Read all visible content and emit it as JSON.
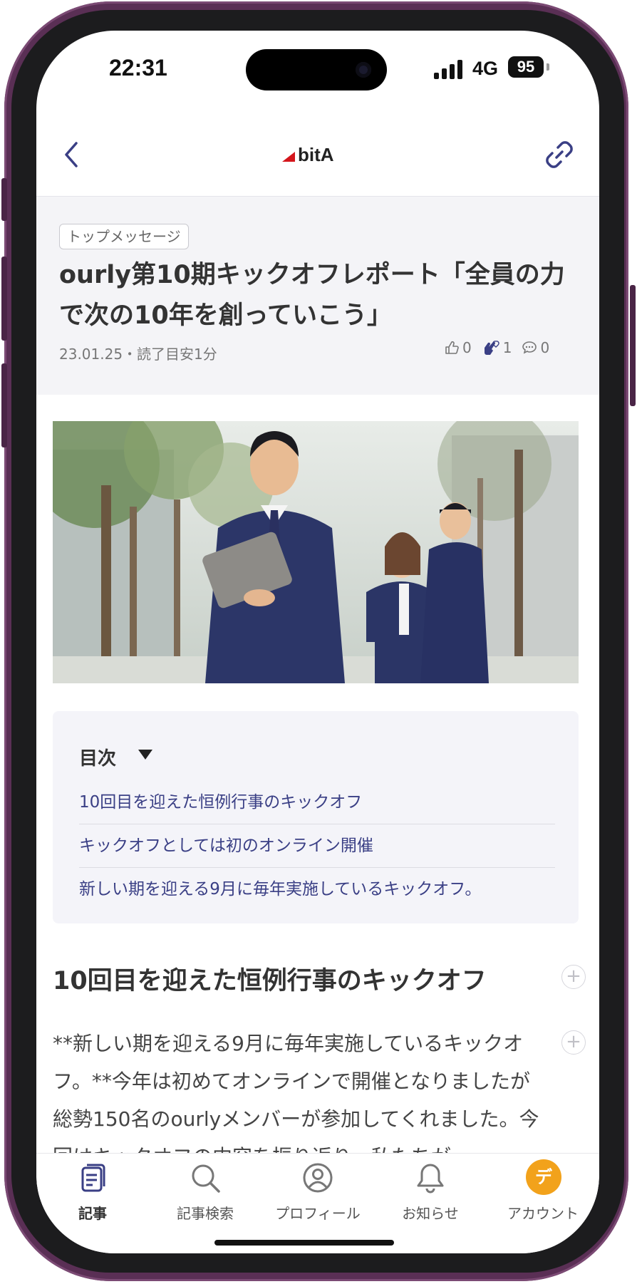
{
  "status_bar": {
    "time": "22:31",
    "network": "4G",
    "battery": "95"
  },
  "header": {
    "logo_text": "bitA"
  },
  "article": {
    "category": "トップメッセージ",
    "title": "ourly第10期キックオフレポート「全員の力で次の10年を創っていこう」",
    "date_read": "23.01.25・読了目安1分",
    "reactions": {
      "likes": "0",
      "claps": "1",
      "comments": "0"
    }
  },
  "toc": {
    "title": "目次",
    "items": [
      "10回目を迎えた恒例行事のキックオフ",
      "キックオフとしては初のオンライン開催",
      "新しい期を迎える9月に毎年実施しているキックオフ。"
    ]
  },
  "body": {
    "section_heading": "10回目を迎えた恒例行事のキックオフ",
    "paragraph": "**新しい期を迎える9月に毎年実施しているキックオフ。**今年は初めてオンラインで開催となりましたが総勢150名のourlyメンバーが参加してくれました。今回はキックオフの内容を振り返り、私たちが"
  },
  "bottom_nav": {
    "items": [
      {
        "label": "記事",
        "icon": "article-icon",
        "active": true
      },
      {
        "label": "記事検索",
        "icon": "search-icon",
        "active": false
      },
      {
        "label": "プロフィール",
        "icon": "profile-icon",
        "active": false
      },
      {
        "label": "お知らせ",
        "icon": "bell-icon",
        "active": false
      },
      {
        "label": "アカウント",
        "icon": "account-avatar",
        "active": false
      }
    ],
    "avatar_initial": "デ"
  },
  "colors": {
    "accent": "#3a3f85",
    "avatar_bg": "#f2a21b",
    "logo_red": "#d4161c",
    "frame": "#5a2f55"
  }
}
